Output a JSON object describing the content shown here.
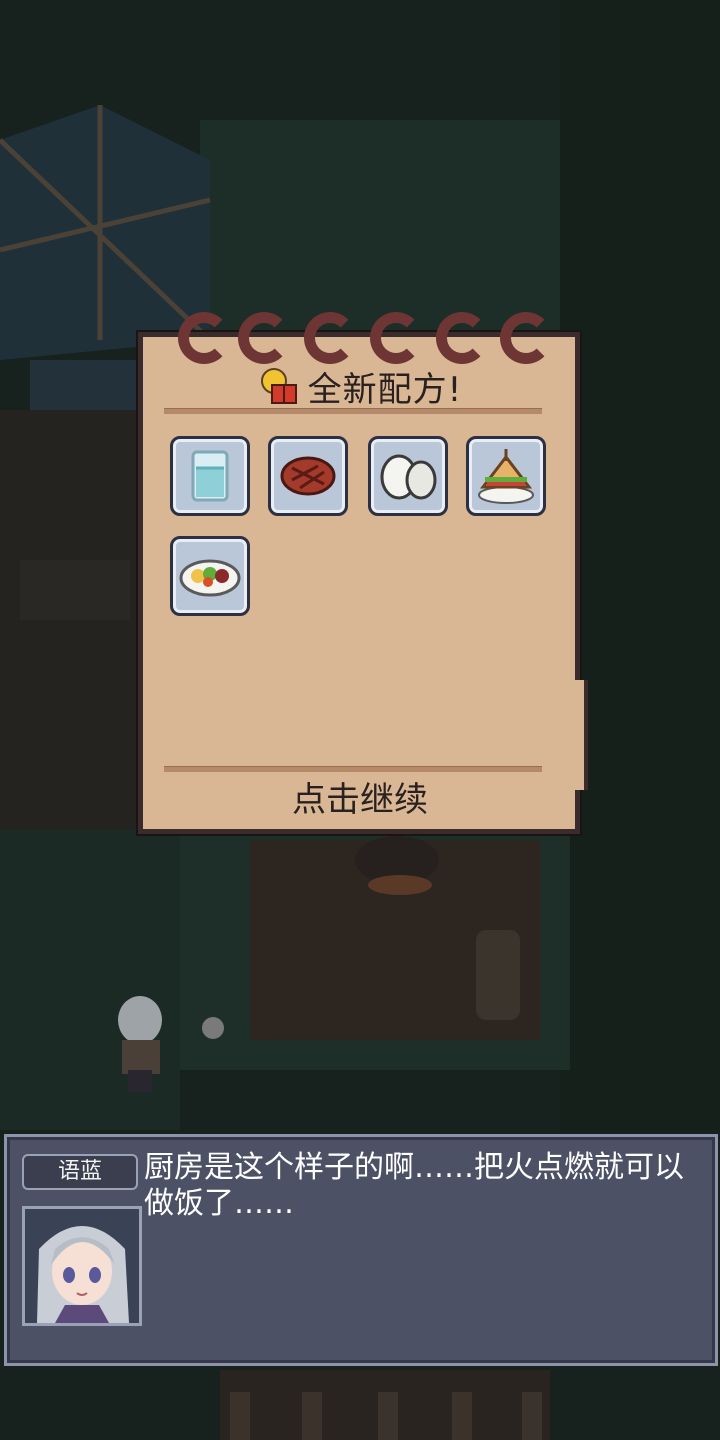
{
  "popup": {
    "title": "全新配方!",
    "continue_label": "点击继续",
    "recipes": [
      {
        "icon": "water-glass-icon"
      },
      {
        "icon": "steak-icon"
      },
      {
        "icon": "eggs-icon"
      },
      {
        "icon": "sandwich-icon"
      },
      {
        "icon": "salad-bowl-icon"
      }
    ]
  },
  "dialog": {
    "speaker": "语蓝",
    "text": "厨房是这个样子的啊……把火点燃就可以做饭了……"
  }
}
